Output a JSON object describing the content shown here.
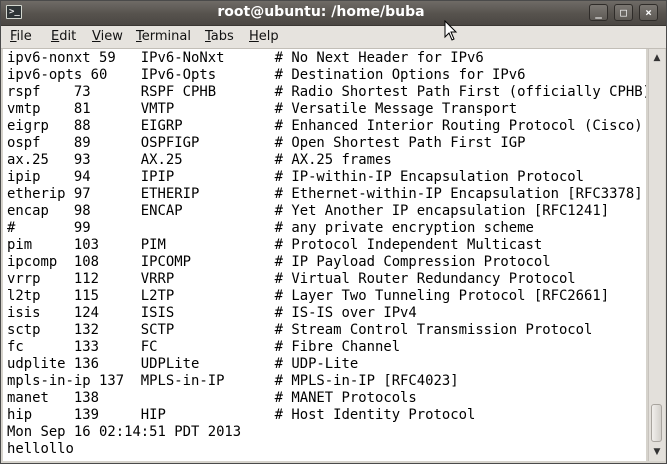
{
  "window": {
    "title": "root@ubuntu: /home/buba",
    "title_icon": "terminal-icon",
    "buttons": {
      "minimize_icon": "minimize-icon",
      "minimize_glyph": "_",
      "maximize_icon": "maximize-icon",
      "maximize_glyph": "□",
      "close_icon": "close-icon",
      "close_glyph": "×"
    }
  },
  "menubar": {
    "items": [
      {
        "mnemonic": "F",
        "rest": "ile"
      },
      {
        "mnemonic": "E",
        "rest": "dit"
      },
      {
        "mnemonic": "V",
        "rest": "iew"
      },
      {
        "mnemonic": "T",
        "rest": "erminal"
      },
      {
        "mnemonic": "T",
        "rest": "abs"
      },
      {
        "mnemonic": "H",
        "rest": "elp"
      }
    ]
  },
  "terminal": {
    "lines": [
      "ipv6-nonxt 59   IPv6-NoNxt      # No Next Header for IPv6",
      "ipv6-opts 60    IPv6-Opts       # Destination Options for IPv6",
      "rspf    73      RSPF CPHB       # Radio Shortest Path First (officially CPHB)",
      "vmtp    81      VMTP            # Versatile Message Transport",
      "eigrp   88      EIGRP           # Enhanced Interior Routing Protocol (Cisco)",
      "ospf    89      OSPFIGP         # Open Shortest Path First IGP",
      "ax.25   93      AX.25           # AX.25 frames",
      "ipip    94      IPIP            # IP-within-IP Encapsulation Protocol",
      "etherip 97      ETHERIP         # Ethernet-within-IP Encapsulation [RFC3378]",
      "encap   98      ENCAP           # Yet Another IP encapsulation [RFC1241]",
      "#       99                      # any private encryption scheme",
      "pim     103     PIM             # Protocol Independent Multicast",
      "ipcomp  108     IPCOMP          # IP Payload Compression Protocol",
      "vrrp    112     VRRP            # Virtual Router Redundancy Protocol",
      "l2tp    115     L2TP            # Layer Two Tunneling Protocol [RFC2661]",
      "isis    124     ISIS            # IS-IS over IPv4",
      "sctp    132     SCTP            # Stream Control Transmission Protocol",
      "fc      133     FC              # Fibre Channel",
      "udplite 136     UDPLite         # UDP-Lite",
      "mpls-in-ip 137  MPLS-in-IP      # MPLS-in-IP [RFC4023]",
      "manet   138                     # MANET Protocols",
      "hip     139     HIP             # Host Identity Protocol",
      "Mon Sep 16 02:14:51 PDT 2013",
      "hellollo"
    ]
  },
  "scrollbar": {
    "up_icon": "scroll-up-arrow-icon",
    "up_glyph": "▲",
    "down_icon": "scroll-down-arrow-icon",
    "down_glyph": "▼",
    "position": 1.0
  }
}
